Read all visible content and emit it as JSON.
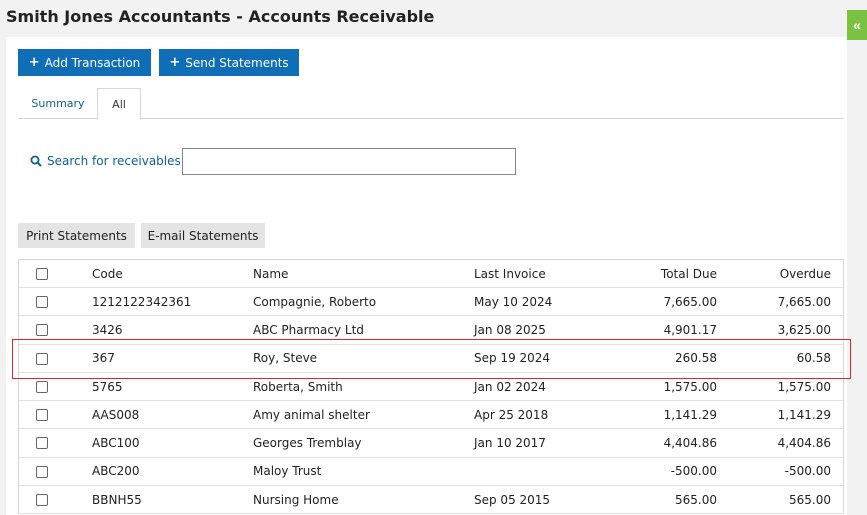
{
  "page_title": "Smith Jones Accountants - Accounts Receivable",
  "collapse_glyph": "«",
  "toolbar": {
    "add_transaction": "Add Transaction",
    "send_statements": "Send Statements"
  },
  "tabs": [
    {
      "label": "Summary",
      "active": false
    },
    {
      "label": "All",
      "active": true
    }
  ],
  "search": {
    "label": "Search for receivables",
    "value": ""
  },
  "actions": {
    "print_statements": "Print Statements",
    "email_statements": "E-mail Statements"
  },
  "table": {
    "columns": [
      "Code",
      "Name",
      "Last Invoice",
      "Total Due",
      "Overdue"
    ],
    "rows": [
      {
        "code": "1212122342361",
        "name": "Compagnie, Roberto",
        "last_invoice": "May 10 2024",
        "total_due": "7,665.00",
        "overdue": "7,665.00"
      },
      {
        "code": "3426",
        "name": "ABC Pharmacy Ltd",
        "last_invoice": "Jan 08 2025",
        "total_due": "4,901.17",
        "overdue": "3,625.00"
      },
      {
        "code": "367",
        "name": "Roy, Steve",
        "last_invoice": "Sep 19 2024",
        "total_due": "260.58",
        "overdue": "60.58"
      },
      {
        "code": "5765",
        "name": "Roberta, Smith",
        "last_invoice": "Jan 02 2024",
        "total_due": "1,575.00",
        "overdue": "1,575.00"
      },
      {
        "code": "AAS008",
        "name": "Amy animal shelter",
        "last_invoice": "Apr 25 2018",
        "total_due": "1,141.29",
        "overdue": "1,141.29"
      },
      {
        "code": "ABC100",
        "name": "Georges Tremblay",
        "last_invoice": "Jan 10 2017",
        "total_due": "4,404.86",
        "overdue": "4,404.86"
      },
      {
        "code": "ABC200",
        "name": "Maloy Trust",
        "last_invoice": "",
        "total_due": "-500.00",
        "overdue": "-500.00"
      },
      {
        "code": "BBNH55",
        "name": "Nursing Home",
        "last_invoice": "Sep 05 2015",
        "total_due": "565.00",
        "overdue": "565.00"
      }
    ]
  },
  "colors": {
    "primary_button": "#0f6eb6",
    "link_blue": "#0f5e9c",
    "collapse_tab": "#7cc242",
    "highlight_border": "#d9262c"
  }
}
